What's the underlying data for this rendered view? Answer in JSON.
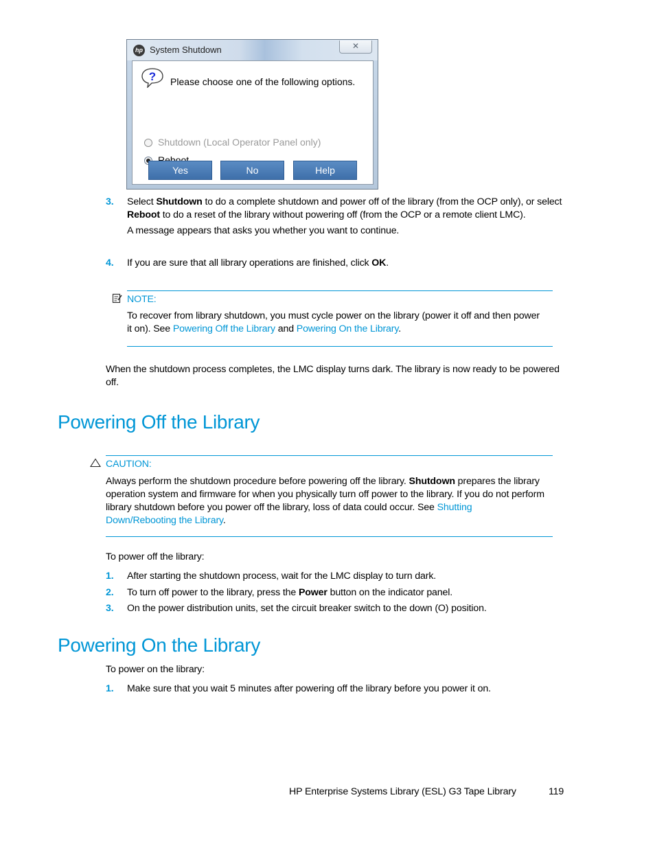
{
  "dialog": {
    "title": "System Shutdown",
    "logo": "hp",
    "close_glyph": "✕",
    "message": "Please choose one of the following options.",
    "options": [
      {
        "label": "Shutdown (Local Operator Panel only)",
        "selected": false,
        "enabled": false
      },
      {
        "label": "Reboot",
        "selected": true,
        "enabled": true
      }
    ],
    "buttons": [
      "Yes",
      "No",
      "Help"
    ]
  },
  "steps_top": [
    {
      "number": "3.",
      "parts": [
        "Select ",
        "Shutdown",
        " to do a complete shutdown and power off of the library (from the OCP only), or select ",
        "Reboot",
        " to do a reset of the library without powering off (from the OCP or a remote client LMC)."
      ],
      "subtext": "A message appears that asks you whether you want to continue."
    },
    {
      "number": "4.",
      "parts": [
        "If you are sure that all library operations are finished, click ",
        "OK",
        "."
      ]
    }
  ],
  "note": {
    "label": "NOTE:",
    "text_1": "To recover from library shutdown, you must cycle power on the library (power it off and then power it on). See ",
    "link_1": "Powering Off the Library",
    "text_2": " and ",
    "link_2": "Powering On the Library",
    "text_3": "."
  },
  "shutdown_complete": "When the shutdown process completes, the LMC display turns dark. The library is now ready to be powered off.",
  "section_off": {
    "heading": "Powering Off the Library",
    "caution": {
      "label": "CAUTION:",
      "text_1": "Always perform the shutdown procedure before powering off the library. ",
      "bold": "Shutdown",
      "text_2": " prepares the library operation system and firmware for when you physically turn off power to the library. If you do not perform library shutdown before you power off the library, loss of data could occur. See ",
      "link": "Shutting Down/Rebooting the Library",
      "text_3": "."
    },
    "intro": "To power off the library:",
    "steps": [
      {
        "number": "1.",
        "pre": "After starting the shutdown process, wait for the LMC display to turn dark.",
        "bold": "",
        "post": ""
      },
      {
        "number": "2.",
        "pre": "To turn off power to the library, press the ",
        "bold": "Power",
        "post": " button on the indicator panel."
      },
      {
        "number": "3.",
        "pre": "On the power distribution units, set the circuit breaker switch to the down (O) position.",
        "bold": "",
        "post": ""
      }
    ]
  },
  "section_on": {
    "heading": "Powering On the Library",
    "intro": "To power on the library:",
    "steps": [
      {
        "number": "1.",
        "text": "Make sure that you wait 5 minutes after powering off the library before you power it on."
      }
    ]
  },
  "footer": {
    "title": "HP Enterprise Systems Library (ESL) G3 Tape Library",
    "page_number": "119"
  },
  "colors": {
    "accent": "#0096d6",
    "dialog_button": "#4a7cb7"
  }
}
